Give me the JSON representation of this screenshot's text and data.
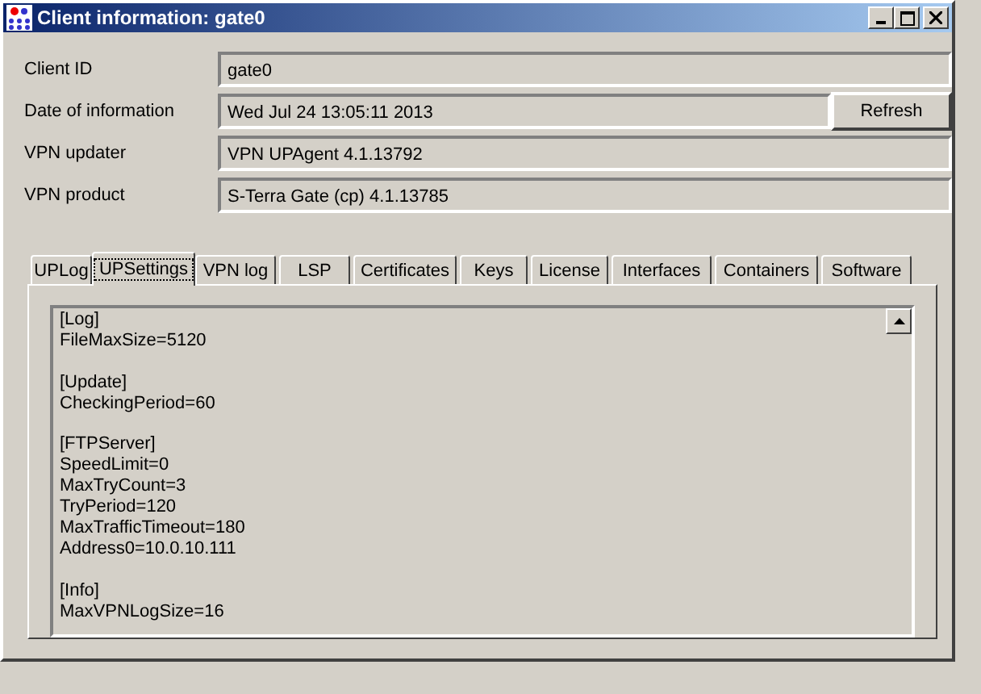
{
  "window": {
    "title": "Client information: gate0",
    "controls": [
      {
        "kind": "minimize"
      },
      {
        "kind": "maximize"
      },
      {
        "kind": "close"
      }
    ]
  },
  "fields": [
    {
      "label": "Client ID",
      "value": "gate0"
    },
    {
      "label": "Date of information",
      "value": "Wed Jul 24 13:05:11 2013",
      "button": "Refresh"
    },
    {
      "label": "VPN updater",
      "value": "VPN UPAgent 4.1.13792"
    },
    {
      "label": "VPN product",
      "value": "S-Terra Gate (cp) 4.1.13785"
    }
  ],
  "tabs": [
    {
      "label": "UPLog",
      "selected": false
    },
    {
      "label": "UPSettings",
      "selected": true
    },
    {
      "label": "VPN log",
      "selected": false
    },
    {
      "label": "LSP",
      "selected": false
    },
    {
      "label": "Certificates",
      "selected": false
    },
    {
      "label": "Keys",
      "selected": false
    },
    {
      "label": "License",
      "selected": false
    },
    {
      "label": "Interfaces",
      "selected": false
    },
    {
      "label": "Containers",
      "selected": false
    },
    {
      "label": "Software",
      "selected": false
    }
  ],
  "settings_text": "[Log]\nFileMaxSize=5120\n\n[Update]\nCheckingPeriod=60\n\n[FTPServer]\nSpeedLimit=0\nMaxTryCount=3\nTryPeriod=120\nMaxTrafficTimeout=180\nAddress0=10.0.10.111\n\n[Info]\nMaxVPNLogSize=16"
}
